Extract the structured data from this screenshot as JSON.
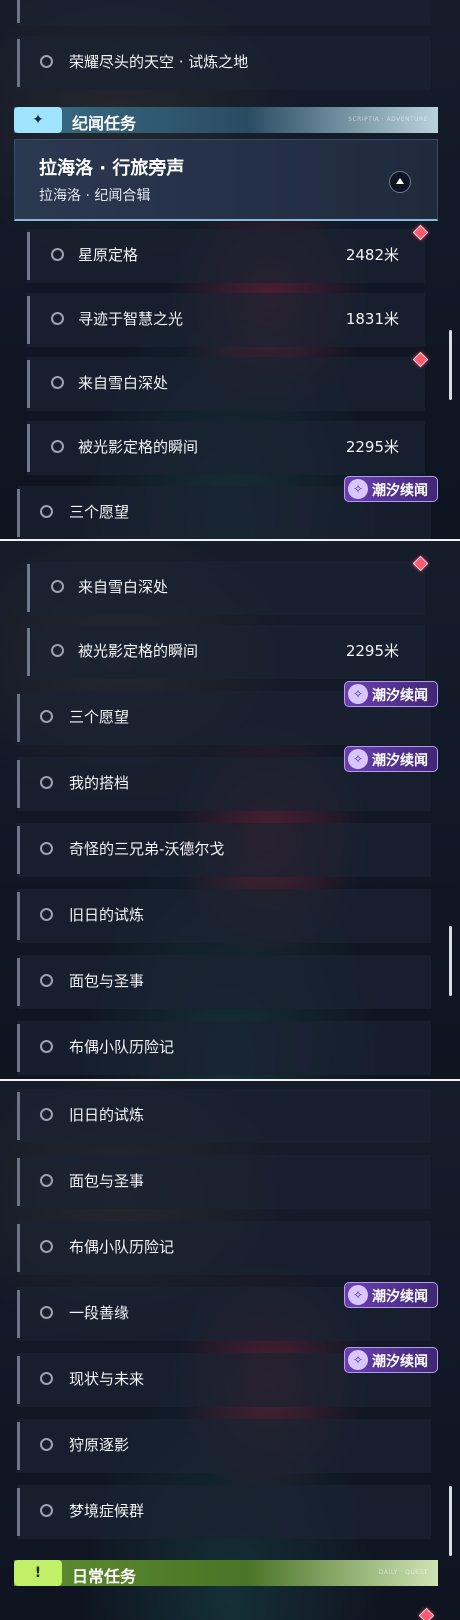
{
  "sections": {
    "story": {
      "title": "纪闻任务",
      "badge_icon": "sparkle-icon",
      "tag": "SCRIPTIA · ADVENTURE"
    },
    "daily": {
      "title": "日常任务",
      "badge_icon": "exclamation-icon",
      "tag": "DAILY · QUEST"
    }
  },
  "quest_card": {
    "title": "拉海洛 · 行旅旁声",
    "subtitle": "拉海洛 · 纪闻合辑",
    "collapse_icon": "chevron-up-icon"
  },
  "chip_label": "潮汐续闻",
  "panel1": {
    "rows": [
      {
        "label": "荣耀尽头的天空 · 试炼之地"
      },
      {
        "label": "星原定格",
        "distance": "2482米"
      },
      {
        "label": "寻迹于智慧之光",
        "distance": "1831米"
      },
      {
        "label": "来自雪白深处"
      },
      {
        "label": "被光影定格的瞬间",
        "distance": "2295米"
      },
      {
        "label": "三个愿望"
      }
    ]
  },
  "panel2": {
    "rows": [
      {
        "label": "来自雪白深处"
      },
      {
        "label": "被光影定格的瞬间",
        "distance": "2295米"
      },
      {
        "label": "三个愿望"
      },
      {
        "label": "我的搭档"
      },
      {
        "label": "奇怪的三兄弟-沃德尔戈"
      },
      {
        "label": "旧日的试炼"
      },
      {
        "label": "面包与圣事"
      },
      {
        "label": "布偶小队历险记"
      }
    ]
  },
  "panel3": {
    "rows": [
      {
        "label": "旧日的试炼"
      },
      {
        "label": "面包与圣事"
      },
      {
        "label": "布偶小队历险记"
      },
      {
        "label": "一段善缘"
      },
      {
        "label": "现状与未来"
      },
      {
        "label": "狩原逐影"
      },
      {
        "label": "梦境症候群"
      }
    ]
  },
  "colors": {
    "story_accent": "#9fe3ff",
    "daily_accent": "#bff068",
    "tracked_marker": "#ff5a72",
    "chip_purple": "#6a3fb0"
  }
}
